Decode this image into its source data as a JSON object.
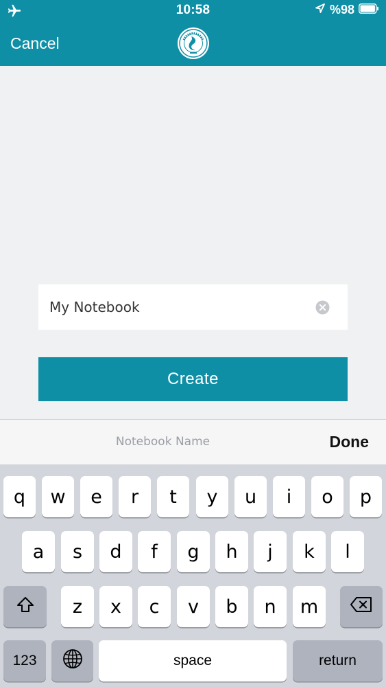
{
  "status_bar": {
    "time": "10:58",
    "battery": "%98",
    "icons": [
      "airplane-icon",
      "location-arrow-icon",
      "battery-icon"
    ]
  },
  "nav": {
    "cancel_label": "Cancel",
    "logo_icon": "university-logo"
  },
  "form": {
    "notebook_name_value": "My Notebook",
    "create_label": "Create"
  },
  "keyboard_accessory": {
    "field_label": "Notebook Name",
    "done_label": "Done"
  },
  "keyboard": {
    "row1": [
      "q",
      "w",
      "e",
      "r",
      "t",
      "y",
      "u",
      "i",
      "o",
      "p"
    ],
    "row2": [
      "a",
      "s",
      "d",
      "f",
      "g",
      "h",
      "j",
      "k",
      "l"
    ],
    "row3": [
      "z",
      "x",
      "c",
      "v",
      "b",
      "n",
      "m"
    ],
    "numbers_label": "123",
    "space_label": "space",
    "return_label": "return"
  },
  "colors": {
    "brand": "#0f8fa6",
    "background": "#eff1f2",
    "keyboard": "#d2d5db"
  }
}
